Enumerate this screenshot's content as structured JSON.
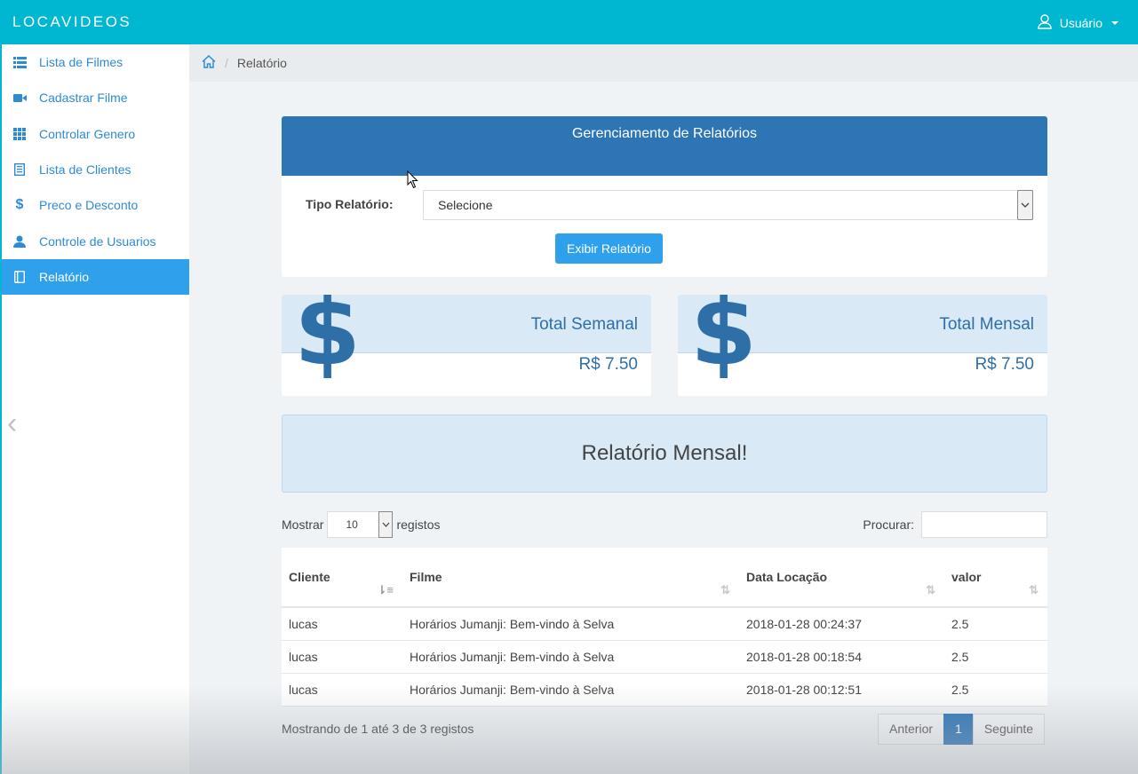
{
  "app": {
    "brand": "LOCAVIDEOS",
    "user_label": "Usuário"
  },
  "sidebar": {
    "items": [
      {
        "label": "Lista de Filmes",
        "icon": "list-icon"
      },
      {
        "label": "Cadastrar Filme",
        "icon": "video-camera-icon"
      },
      {
        "label": "Controlar Genero",
        "icon": "grid-icon"
      },
      {
        "label": "Lista de Clientes",
        "icon": "address-book-icon"
      },
      {
        "label": "Preco e Desconto",
        "icon": "dollar-icon"
      },
      {
        "label": "Controle de Usuarios",
        "icon": "user-icon"
      },
      {
        "label": "Relatório",
        "icon": "book-icon",
        "active": true
      }
    ]
  },
  "breadcrumb": {
    "current": "Relatório"
  },
  "report_panel": {
    "title": "Gerenciamento de Relatórios",
    "type_label": "Tipo Relatório:",
    "type_value": "Selecione",
    "button": "Exibir Relatório"
  },
  "stats": {
    "weekly": {
      "title": "Total Semanal",
      "value": "R$ 7.50",
      "symbol": "$"
    },
    "monthly": {
      "title": "Total Mensal",
      "value": "R$ 7.50",
      "symbol": "$"
    }
  },
  "banner": "Relatório Mensal!",
  "table_controls": {
    "show_label": "Mostrar",
    "page_length": "10",
    "records_label": "registos",
    "search_label": "Procurar:"
  },
  "table": {
    "headers": [
      "Cliente",
      "Filme",
      "Data Locação",
      "valor"
    ],
    "rows": [
      [
        "lucas",
        "Horários Jumanji: Bem-vindo à Selva",
        "2018-01-28 00:24:37",
        "2.5"
      ],
      [
        "lucas",
        "Horários Jumanji: Bem-vindo à Selva",
        "2018-01-28 00:18:54",
        "2.5"
      ],
      [
        "lucas",
        "Horários Jumanji: Bem-vindo à Selva",
        "2018-01-28 00:12:51",
        "2.5"
      ]
    ]
  },
  "footer": {
    "info": "Mostrando de 1 até 3 de 3 registos",
    "prev": "Anterior",
    "page": "1",
    "next": "Seguinte"
  },
  "colors": {
    "topbar": "#00b7d1",
    "accent": "#2ea0ec",
    "panel_header": "#2e75b6",
    "stat_text": "#2e6fa8"
  }
}
